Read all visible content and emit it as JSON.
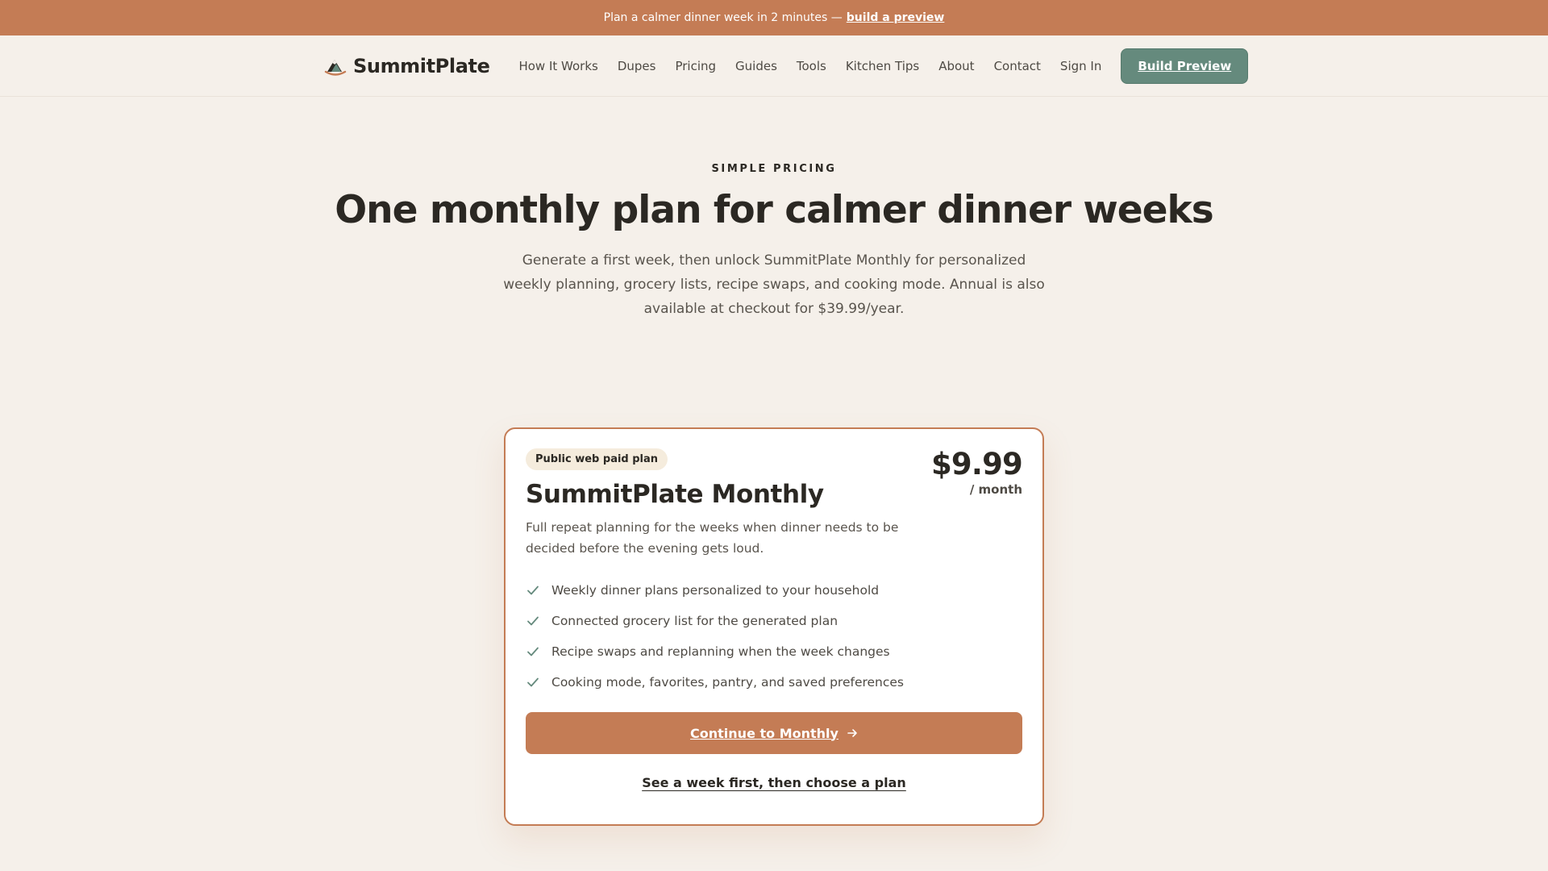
{
  "announcement": {
    "text": "Plan a calmer dinner week in 2 minutes —",
    "link": "build a preview"
  },
  "nav": {
    "brand": "SummitPlate",
    "links": [
      "How It Works",
      "Dupes",
      "Pricing",
      "Guides",
      "Tools",
      "Kitchen Tips",
      "About",
      "Contact",
      "Sign In"
    ],
    "cta": "Build Preview"
  },
  "hero": {
    "eyebrow": "SIMPLE PRICING",
    "title": "One monthly plan for calmer dinner weeks",
    "subtitle": "Generate a first week, then unlock SummitPlate Monthly for personalized weekly planning, grocery lists, recipe swaps, and cooking mode. Annual is also available at checkout for $39.99/year."
  },
  "plan": {
    "badge": "Public web paid plan",
    "name": "SummitPlate Monthly",
    "price": "$9.99",
    "period": "/ month",
    "description": "Full repeat planning for the weeks when dinner needs to be decided before the evening gets loud.",
    "features": [
      "Weekly dinner plans personalized to your household",
      "Connected grocery list for the generated plan",
      "Recipe swaps and replanning when the week changes",
      "Cooking mode, favorites, pantry, and saved preferences"
    ],
    "cta": "Continue to Monthly",
    "secondary_link": "See a week first, then choose a plan"
  },
  "colors": {
    "accent": "#c47c55",
    "nav_cta": "#658a7d",
    "background": "#f5f0ea",
    "check": "#658a7d"
  },
  "icons": {
    "brand": "mountain-plate-icon",
    "feature": "check-icon",
    "cta": "arrow-right-icon"
  }
}
